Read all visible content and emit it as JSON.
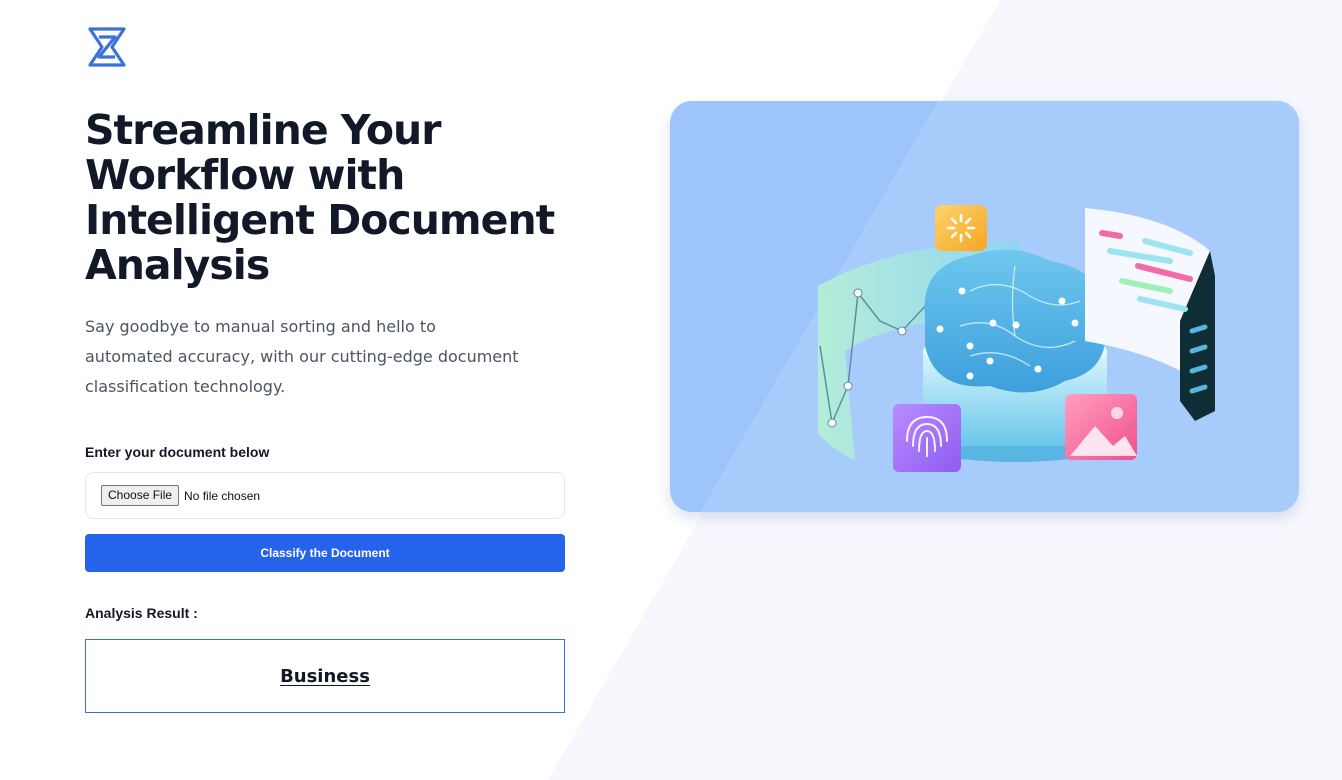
{
  "brand": {
    "logo_icon": "z-hourglass-logo-icon",
    "color": "#3b72d9"
  },
  "hero": {
    "headline": "Streamline Your Workflow with Intelligent Document Analysis",
    "subtext": "Say goodbye to manual sorting and hello to automated accuracy, with our cutting-edge document classification technology.",
    "illustration_icon": "ai-brain-document-illustration"
  },
  "form": {
    "label": "Enter your document below",
    "file_button_label": "Choose File",
    "file_status": "No file chosen",
    "submit_label": "Classify the Document",
    "accent_color": "#2563eb"
  },
  "result": {
    "label": "Analysis Result :",
    "value": "Business"
  }
}
